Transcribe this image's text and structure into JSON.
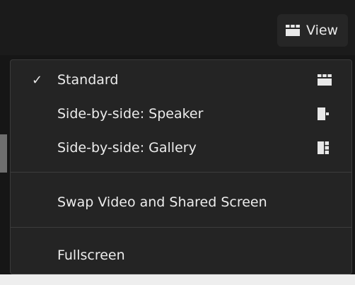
{
  "toolbar": {
    "view_label": "View",
    "view_icon": "gallery-grid-icon"
  },
  "menu": {
    "items": [
      {
        "label": "Standard",
        "checked": true,
        "icon": "gallery-grid-icon"
      },
      {
        "label": "Side-by-side: Speaker",
        "checked": false,
        "icon": "speaker-layout-icon"
      },
      {
        "label": "Side-by-side: Gallery",
        "checked": false,
        "icon": "gallery-side-icon"
      },
      {
        "label": "Swap Video and Shared Screen",
        "checked": false
      },
      {
        "label": "Fullscreen",
        "checked": false
      }
    ],
    "check_glyph": "✓"
  },
  "colors": {
    "background": "#161616",
    "menu_background": "#242424",
    "text": "#ececec",
    "divider": "#3c3c3c"
  }
}
